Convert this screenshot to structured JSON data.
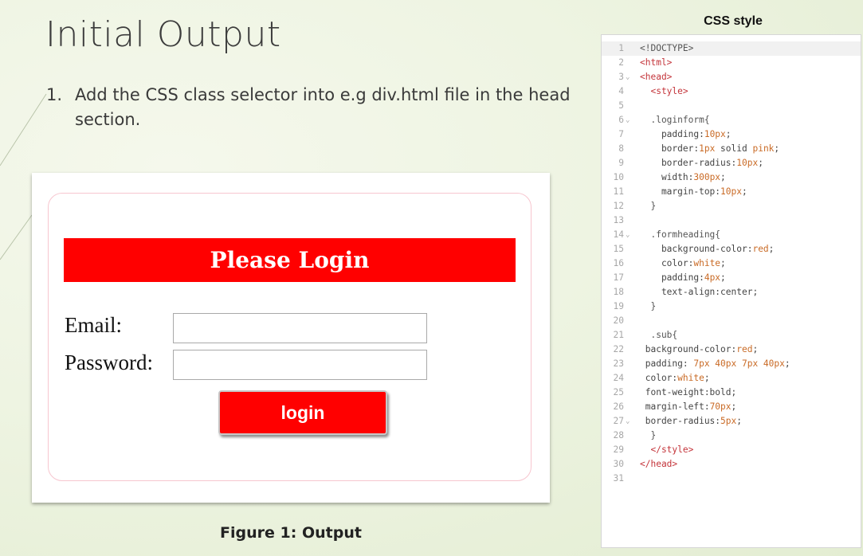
{
  "slide": {
    "title": "Initial Output",
    "bullet_number": "1.",
    "bullet_text": "Add the CSS class selector into e.g div.html file in the head section."
  },
  "output_preview": {
    "heading": "Please Login",
    "email_label": "Email:",
    "password_label": "Password:",
    "email_value": "",
    "password_value": "",
    "button_label": "login",
    "caption": "Figure 1: Output"
  },
  "code_panel": {
    "title": "CSS style",
    "lines": [
      {
        "n": "1",
        "fold": "",
        "tokens": [
          {
            "t": "<!DOCTYPE>",
            "c": "plain"
          }
        ]
      },
      {
        "n": "2",
        "fold": "",
        "tokens": [
          {
            "t": "<html>",
            "c": "tag"
          }
        ]
      },
      {
        "n": "3",
        "fold": "v",
        "tokens": [
          {
            "t": "<head>",
            "c": "tag"
          }
        ]
      },
      {
        "n": "4",
        "fold": "",
        "tokens": [
          {
            "t": "  <style>",
            "c": "tag"
          }
        ]
      },
      {
        "n": "5",
        "fold": "",
        "tokens": []
      },
      {
        "n": "6",
        "fold": "v",
        "tokens": [
          {
            "t": "  .loginform{",
            "c": "plain"
          }
        ]
      },
      {
        "n": "7",
        "fold": "",
        "tokens": [
          {
            "t": "    padding:",
            "c": "prop"
          },
          {
            "t": "10px",
            "c": "val"
          },
          {
            "t": ";",
            "c": "prop"
          }
        ]
      },
      {
        "n": "8",
        "fold": "",
        "tokens": [
          {
            "t": "    border:",
            "c": "prop"
          },
          {
            "t": "1px",
            "c": "val"
          },
          {
            "t": " solid ",
            "c": "prop"
          },
          {
            "t": "pink",
            "c": "val"
          },
          {
            "t": ";",
            "c": "prop"
          }
        ]
      },
      {
        "n": "9",
        "fold": "",
        "tokens": [
          {
            "t": "    border-radius:",
            "c": "prop"
          },
          {
            "t": "10px",
            "c": "val"
          },
          {
            "t": ";",
            "c": "prop"
          }
        ]
      },
      {
        "n": "10",
        "fold": "",
        "tokens": [
          {
            "t": "    width:",
            "c": "prop"
          },
          {
            "t": "300px",
            "c": "val"
          },
          {
            "t": ";",
            "c": "prop"
          }
        ]
      },
      {
        "n": "11",
        "fold": "",
        "tokens": [
          {
            "t": "    margin-top:",
            "c": "prop"
          },
          {
            "t": "10px",
            "c": "val"
          },
          {
            "t": ";",
            "c": "prop"
          }
        ]
      },
      {
        "n": "12",
        "fold": "",
        "tokens": [
          {
            "t": "  }",
            "c": "plain"
          }
        ]
      },
      {
        "n": "13",
        "fold": "",
        "tokens": []
      },
      {
        "n": "14",
        "fold": "v",
        "tokens": [
          {
            "t": "  .formheading{",
            "c": "plain"
          }
        ]
      },
      {
        "n": "15",
        "fold": "",
        "tokens": [
          {
            "t": "    background-color:",
            "c": "prop"
          },
          {
            "t": "red",
            "c": "val"
          },
          {
            "t": ";",
            "c": "prop"
          }
        ]
      },
      {
        "n": "16",
        "fold": "",
        "tokens": [
          {
            "t": "    color:",
            "c": "prop"
          },
          {
            "t": "white",
            "c": "val"
          },
          {
            "t": ";",
            "c": "prop"
          }
        ]
      },
      {
        "n": "17",
        "fold": "",
        "tokens": [
          {
            "t": "    padding:",
            "c": "prop"
          },
          {
            "t": "4px",
            "c": "val"
          },
          {
            "t": ";",
            "c": "prop"
          }
        ]
      },
      {
        "n": "18",
        "fold": "",
        "tokens": [
          {
            "t": "    text-align:center;",
            "c": "prop"
          }
        ]
      },
      {
        "n": "19",
        "fold": "",
        "tokens": [
          {
            "t": "  }",
            "c": "plain"
          }
        ]
      },
      {
        "n": "20",
        "fold": "",
        "tokens": []
      },
      {
        "n": "21",
        "fold": "",
        "tokens": [
          {
            "t": "  .sub{",
            "c": "plain"
          }
        ]
      },
      {
        "n": "22",
        "fold": "",
        "tokens": [
          {
            "t": " background-color:",
            "c": "prop"
          },
          {
            "t": "red",
            "c": "val"
          },
          {
            "t": ";",
            "c": "prop"
          }
        ]
      },
      {
        "n": "23",
        "fold": "",
        "tokens": [
          {
            "t": " padding: ",
            "c": "prop"
          },
          {
            "t": "7px 40px 7px 40px",
            "c": "val"
          },
          {
            "t": ";",
            "c": "prop"
          }
        ]
      },
      {
        "n": "24",
        "fold": "",
        "tokens": [
          {
            "t": " color:",
            "c": "prop"
          },
          {
            "t": "white",
            "c": "val"
          },
          {
            "t": ";",
            "c": "prop"
          }
        ]
      },
      {
        "n": "25",
        "fold": "",
        "tokens": [
          {
            "t": " font-weight:bold;",
            "c": "prop"
          }
        ]
      },
      {
        "n": "26",
        "fold": "",
        "tokens": [
          {
            "t": " margin-left:",
            "c": "prop"
          },
          {
            "t": "70px",
            "c": "val"
          },
          {
            "t": ";",
            "c": "prop"
          }
        ]
      },
      {
        "n": "27",
        "fold": "v",
        "tokens": [
          {
            "t": " border-radius:",
            "c": "prop"
          },
          {
            "t": "5px",
            "c": "val"
          },
          {
            "t": ";",
            "c": "prop"
          }
        ]
      },
      {
        "n": "28",
        "fold": "",
        "tokens": [
          {
            "t": "  }",
            "c": "plain"
          }
        ]
      },
      {
        "n": "29",
        "fold": "",
        "tokens": [
          {
            "t": "  </style>",
            "c": "tag"
          }
        ]
      },
      {
        "n": "30",
        "fold": "",
        "tokens": [
          {
            "t": "</head>",
            "c": "tag"
          }
        ]
      },
      {
        "n": "31",
        "fold": "",
        "tokens": []
      }
    ]
  }
}
